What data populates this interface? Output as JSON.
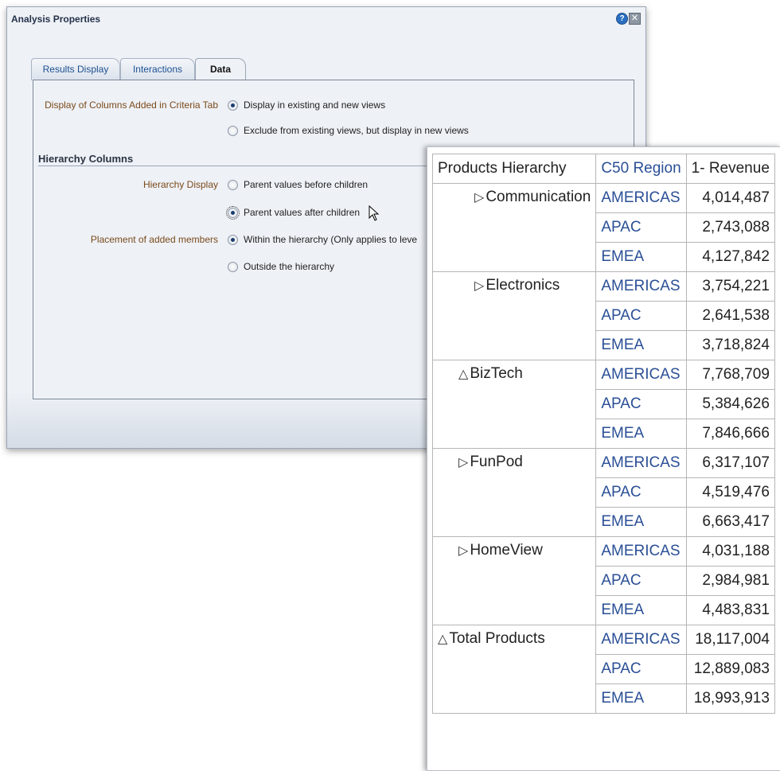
{
  "dialog": {
    "title": "Analysis Properties",
    "help_icon": "?",
    "tabs": [
      {
        "label": "Results Display",
        "active": false
      },
      {
        "label": "Interactions",
        "active": false
      },
      {
        "label": "Data",
        "active": true
      }
    ],
    "display_columns": {
      "label": "Display of Columns Added in Criteria Tab",
      "options": [
        {
          "label": "Display in existing and new views",
          "checked": true
        },
        {
          "label": "Exclude from existing views, but display in new views",
          "checked": false
        }
      ]
    },
    "hierarchy_section_title": "Hierarchy Columns",
    "hierarchy_display": {
      "label": "Hierarchy Display",
      "options": [
        {
          "label": "Parent values before children",
          "checked": false
        },
        {
          "label": "Parent values after children",
          "checked": true
        }
      ]
    },
    "placement": {
      "label": "Placement of added members",
      "options": [
        {
          "label": "Within the hierarchy (Only applies to leve",
          "checked": true
        },
        {
          "label": "Outside the hierarchy",
          "checked": false
        }
      ]
    }
  },
  "table": {
    "headers": [
      "Products Hierarchy",
      "C50 Region",
      "1- Revenue"
    ],
    "groups": [
      {
        "product": "Communication",
        "icon": "▷",
        "indent": 2,
        "rows": [
          [
            "AMERICAS",
            "4,014,487"
          ],
          [
            "APAC",
            "2,743,088"
          ],
          [
            "EMEA",
            "4,127,842"
          ]
        ]
      },
      {
        "product": "Electronics",
        "icon": "▷",
        "indent": 2,
        "rows": [
          [
            "AMERICAS",
            "3,754,221"
          ],
          [
            "APAC",
            "2,641,538"
          ],
          [
            "EMEA",
            "3,718,824"
          ]
        ]
      },
      {
        "product": "BizTech",
        "icon": "△",
        "indent": 1,
        "rows": [
          [
            "AMERICAS",
            "7,768,709"
          ],
          [
            "APAC",
            "5,384,626"
          ],
          [
            "EMEA",
            "7,846,666"
          ]
        ]
      },
      {
        "product": "FunPod",
        "icon": "▷",
        "indent": 1,
        "rows": [
          [
            "AMERICAS",
            "6,317,107"
          ],
          [
            "APAC",
            "4,519,476"
          ],
          [
            "EMEA",
            "6,663,417"
          ]
        ]
      },
      {
        "product": "HomeView",
        "icon": "▷",
        "indent": 1,
        "rows": [
          [
            "AMERICAS",
            "4,031,188"
          ],
          [
            "APAC",
            "2,984,981"
          ],
          [
            "EMEA",
            "4,483,831"
          ]
        ]
      },
      {
        "product": "Total Products",
        "icon": "△",
        "indent": 0,
        "rows": [
          [
            "AMERICAS",
            "18,117,004"
          ],
          [
            "APAC",
            "12,889,083"
          ],
          [
            "EMEA",
            "18,993,913"
          ]
        ]
      }
    ]
  }
}
